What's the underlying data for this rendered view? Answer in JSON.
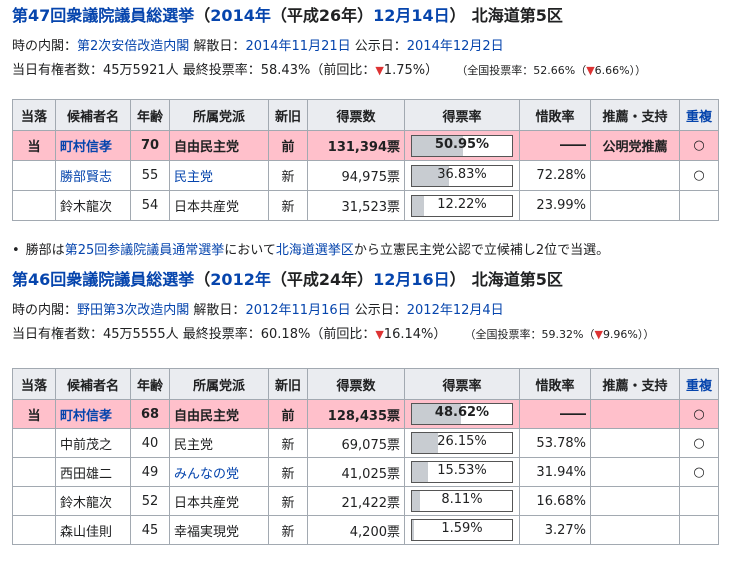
{
  "e2014": {
    "title": {
      "main": "第47回衆議院議員総選挙",
      "date_open": "（",
      "year": "2014年",
      "era": "（平成26年）",
      "day": "12月14日",
      "date_close": "）",
      "district": "北海道第5区"
    },
    "line1": {
      "cabinet_label": "時の内閣：",
      "cabinet": "第2次安倍改造内閣",
      "dissolve_label": " 解散日：",
      "dissolve": "2014年11月21日",
      "announce_label": " 公示日：",
      "announce": "2014年12月2日"
    },
    "line2": {
      "voters": "当日有権者数：45万5921人 最終投票率：58.43%（前回比：",
      "diff_arrow": "▼",
      "diff": "1.75%）",
      "national": "（全国投票率：52.66%（",
      "national_arrow": "▼",
      "national_diff": "6.66%））"
    },
    "headers": [
      "当落",
      "候補者名",
      "年齢",
      "所属党派",
      "新旧",
      "得票数",
      "得票率",
      "惜敗率",
      "推薦・支持",
      "重複"
    ],
    "rows": [
      {
        "result": "当",
        "name": "町村信孝",
        "age": "70",
        "party": "自由民主党",
        "status": "前",
        "votes": "131,394票",
        "rate": "50.95%",
        "rate_value": 50.95,
        "loss": "――",
        "support": "公明党推薦",
        "dup": "○"
      },
      {
        "result": "",
        "name": "勝部賢志",
        "age": "55",
        "party": "民主党",
        "status": "新",
        "votes": "94,975票",
        "rate": "36.83%",
        "rate_value": 36.83,
        "loss": "72.28%",
        "support": "",
        "dup": "○"
      },
      {
        "result": "",
        "name": "鈴木龍次",
        "age": "54",
        "party": "日本共産党",
        "status": "新",
        "votes": "31,523票",
        "rate": "12.22%",
        "rate_value": 12.22,
        "loss": "23.99%",
        "support": "",
        "dup": ""
      }
    ],
    "note": {
      "bullet": "•",
      "t1": "勝部は",
      "l1": "第25回参議院議員通常選挙",
      "t2": "において",
      "l2": "北海道選挙区",
      "t3": "から立憲民主党公認で立候補し2位で当選。"
    }
  },
  "e2012": {
    "title": {
      "main": "第46回衆議院議員総選挙",
      "date_open": "（",
      "year": "2012年",
      "era": "（平成24年）",
      "day": "12月16日",
      "date_close": "）",
      "district": "北海道第5区"
    },
    "line1": {
      "cabinet_label": "時の内閣：",
      "cabinet": "野田第3次改造内閣",
      "dissolve_label": " 解散日：",
      "dissolve": "2012年11月16日",
      "announce_label": " 公示日：",
      "announce": "2012年12月4日"
    },
    "line2": {
      "voters": "当日有権者数：45万5555人 最終投票率：60.18%（前回比：",
      "diff_arrow": "▼",
      "diff": "16.14%）",
      "national": "（全国投票率：59.32%（",
      "national_arrow": "▼",
      "national_diff": "9.96%））"
    },
    "headers": [
      "当落",
      "候補者名",
      "年齢",
      "所属党派",
      "新旧",
      "得票数",
      "得票率",
      "惜敗率",
      "推薦・支持",
      "重複"
    ],
    "rows": [
      {
        "result": "当",
        "name": "町村信孝",
        "age": "68",
        "party": "自由民主党",
        "status": "前",
        "votes": "128,435票",
        "rate": "48.62%",
        "rate_value": 48.62,
        "loss": "――",
        "support": "",
        "dup": "○"
      },
      {
        "result": "",
        "name": "中前茂之",
        "age": "40",
        "party": "民主党",
        "status": "新",
        "votes": "69,075票",
        "rate": "26.15%",
        "rate_value": 26.15,
        "loss": "53.78%",
        "support": "",
        "dup": "○"
      },
      {
        "result": "",
        "name": "西田雄二",
        "age": "49",
        "party": "みんなの党",
        "status": "新",
        "votes": "41,025票",
        "rate": "15.53%",
        "rate_value": 15.53,
        "loss": "31.94%",
        "support": "",
        "dup": "○"
      },
      {
        "result": "",
        "name": "鈴木龍次",
        "age": "52",
        "party": "日本共産党",
        "status": "新",
        "votes": "21,422票",
        "rate": "8.11%",
        "rate_value": 8.11,
        "loss": "16.68%",
        "support": "",
        "dup": ""
      },
      {
        "result": "",
        "name": "森山佳則",
        "age": "45",
        "party": "幸福実現党",
        "status": "新",
        "votes": "4,200票",
        "rate": "1.59%",
        "rate_value": 1.59,
        "loss": "3.27%",
        "support": "",
        "dup": ""
      }
    ]
  },
  "colors": {
    "link": "#0645ad",
    "winner_row": "#ffc0cb",
    "decrease": "#dd3333",
    "bar_fill": "#c8ccd1",
    "header_bg": "#eaecf0"
  }
}
